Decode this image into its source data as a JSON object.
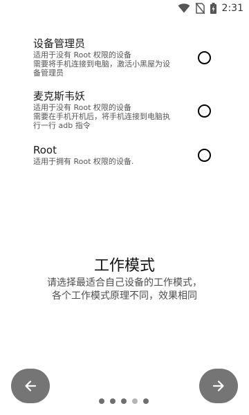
{
  "status_bar": {
    "time": "2:31",
    "icons": [
      "wifi-icon",
      "sim-off-icon",
      "battery-charging-icon"
    ]
  },
  "options": [
    {
      "title": "设备管理员",
      "desc_lines": [
        "适用于没有 Root 权限的设备",
        "需要将手机连接到电脑，激活小黑屋为设",
        "备管理员"
      ],
      "selected": false
    },
    {
      "title": "麦克斯韦妖",
      "desc_lines": [
        "适用于没有 Root 权限的设备",
        "需要在手机开机后，将手机连接到电脑执",
        "行一行 adb 指令"
      ],
      "selected": false
    },
    {
      "title": "Root",
      "desc_lines": [
        "适用于拥有 Root 权限的设备."
      ],
      "selected": false
    }
  ],
  "mode": {
    "title": "工作模式",
    "desc_lines": [
      "请选择最适合自己设备的工作模式，",
      "各个工作模式原理不同，效果相同"
    ]
  },
  "navigation": {
    "prev_icon": "arrow-left-icon",
    "next_icon": "arrow-right-icon",
    "page_count": 5,
    "current_page": 4
  },
  "colors": {
    "nav_button": "#757575",
    "dot": "#707070",
    "dot_active": "#b5b5b5"
  }
}
